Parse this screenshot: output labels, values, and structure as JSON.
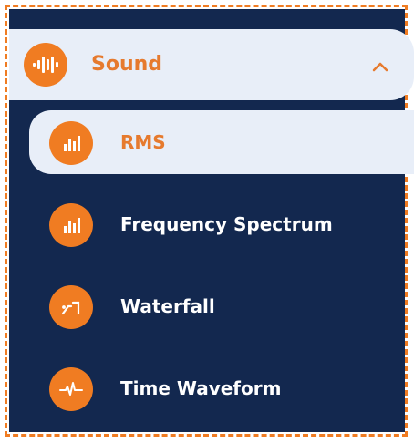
{
  "group": {
    "title": "Sound",
    "icon": "sound-wave-icon",
    "expanded": true
  },
  "items": [
    {
      "label": "RMS",
      "icon": "bar-chart-icon",
      "active": true
    },
    {
      "label": "Frequency Spectrum",
      "icon": "bar-chart-icon",
      "active": false
    },
    {
      "label": "Waterfall",
      "icon": "waterfall-icon",
      "active": false
    },
    {
      "label": "Time Waveform",
      "icon": "waveform-icon",
      "active": false
    }
  ],
  "colors": {
    "panel": "#13284f",
    "accent": "#f07c22",
    "highlight": "#e8eef8",
    "text": "#ffffff"
  }
}
